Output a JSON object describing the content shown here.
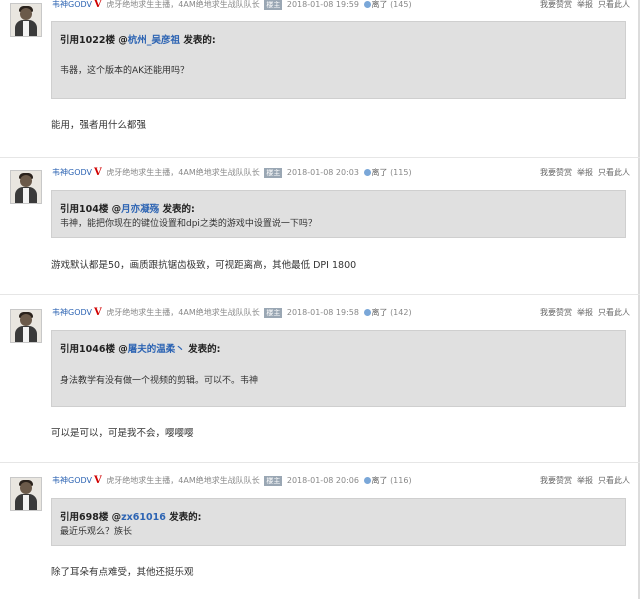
{
  "posts": [
    {
      "author": "韦神GODV",
      "v_mark": "V",
      "title": "虎牙绝地求生主播，4AM绝地求生战队队长",
      "badge": "楼主",
      "timestamp": "2018-01-08 19:59",
      "away_label": "离了",
      "away_count": "(145)",
      "actions": [
        "我要赞赏",
        "举报",
        "只看此人"
      ],
      "quote_prefix": "引用1022楼 @",
      "quote_user": "杭州_吴彦祖",
      "quote_suffix": " 发表的:",
      "quote_text": "韦器，这个版本的AK还能用吗？",
      "reply": "能用，强者用什么都强"
    },
    {
      "author": "韦神GODV",
      "v_mark": "V",
      "title": "虎牙绝地求生主播，4AM绝地求生战队队长",
      "badge": "楼主",
      "timestamp": "2018-01-08 20:03",
      "away_label": "离了",
      "away_count": "(115)",
      "actions": [
        "我要赞赏",
        "举报",
        "只看此人"
      ],
      "quote_prefix": "引用104楼 @",
      "quote_user": "月亦凝殇",
      "quote_suffix": " 发表的:",
      "quote_text": "韦神，能把你现在的键位设置和dpi之类的游戏中设置说一下吗？",
      "reply": "游戏默认都是50，画质跟抗锯齿极致，可视距离高，其他最低 DPI 1800"
    },
    {
      "author": "韦神GODV",
      "v_mark": "V",
      "title": "虎牙绝地求生主播，4AM绝地求生战队队长",
      "badge": "楼主",
      "timestamp": "2018-01-08 19:58",
      "away_label": "离了",
      "away_count": "(142)",
      "actions": [
        "我要赞赏",
        "举报",
        "只看此人"
      ],
      "quote_prefix": "引用1046楼 @",
      "quote_user": "屠夫的温柔丶",
      "quote_suffix": " 发表的:",
      "quote_text": "身法教学有没有做一个视频的剪辑。可以不。韦神",
      "reply": "可以是可以，可是我不会，嘤嘤嘤"
    },
    {
      "author": "韦神GODV",
      "v_mark": "V",
      "title": "虎牙绝地求生主播，4AM绝地求生战队队长",
      "badge": "楼主",
      "timestamp": "2018-01-08 20:06",
      "away_label": "离了",
      "away_count": "(116)",
      "actions": [
        "我要赞赏",
        "举报",
        "只看此人"
      ],
      "quote_prefix": "引用698楼 @",
      "quote_user": "zx61016",
      "quote_suffix": " 发表的:",
      "quote_text": "最近乐观么？族长",
      "reply": "除了耳朵有点难受，其他还挺乐观"
    }
  ]
}
